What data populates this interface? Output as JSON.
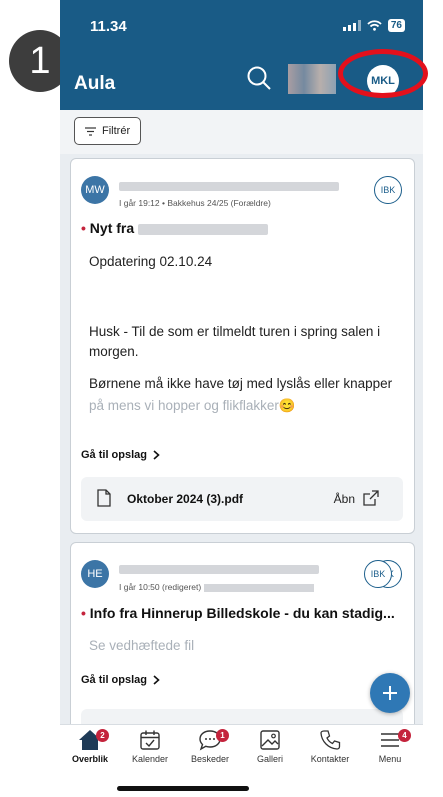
{
  "step_marker": "1",
  "status_bar": {
    "time": "11.34",
    "battery": "76"
  },
  "header": {
    "title": "Aula",
    "avatar_initials": "MKL"
  },
  "toolbar": {
    "filter_label": "Filtrér"
  },
  "posts": [
    {
      "author_initials": "MW",
      "meta": "I går 19:12 • Bakkehus 24/25 (Forældre)",
      "group_badge": "IBK",
      "subject": "Nyt fra",
      "paragraphs": [
        "Opdatering 02.10.24",
        "Husk - Til de som er tilmeldt turen i spring salen i morgen.",
        "Børnene må ikke have tøj med lyslås eller knapper",
        "på mens vi hopper og flikflakker😊"
      ],
      "goto_label": "Gå til opslag",
      "attachment": {
        "filename": "Oktober 2024 (3).pdf",
        "open_label": "Åbn"
      }
    },
    {
      "author_initials": "HE",
      "meta": "I går 10:50 (redigeret)",
      "group_badge": "IBK",
      "group_badge_2": "BK",
      "subject": "Info fra Hinnerup Billedskole - du kan stadig...",
      "preview": "Se vedhæftede fil",
      "goto_label": "Gå til opslag"
    }
  ],
  "tabbar": {
    "items": [
      {
        "label": "Overblik",
        "badge": "2"
      },
      {
        "label": "Kalender"
      },
      {
        "label": "Beskeder",
        "badge": "1"
      },
      {
        "label": "Galleri"
      },
      {
        "label": "Kontakter"
      },
      {
        "label": "Menu",
        "badge": "4"
      }
    ]
  },
  "icons": [
    "search-icon",
    "filter-icon",
    "chevron-right-icon",
    "file-icon",
    "external-link-icon",
    "plus-icon",
    "home-icon",
    "calendar-icon",
    "chat-icon",
    "gallery-icon",
    "phone-icon",
    "menu-icon"
  ],
  "colors": {
    "brand": "#195b86",
    "badge": "#c4233c",
    "fab": "#2f78b5",
    "annotation": "#e3101c"
  }
}
